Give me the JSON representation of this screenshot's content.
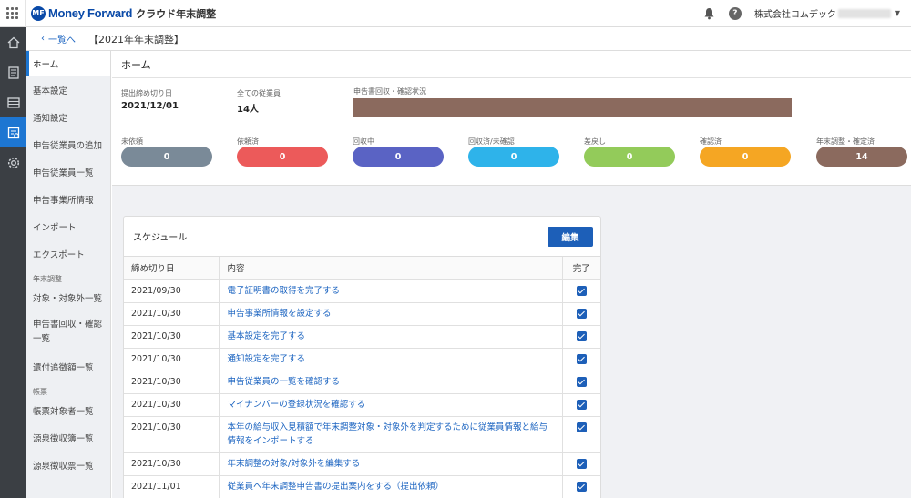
{
  "topbar": {
    "brand_mark": "MF",
    "brand_name": "Money Forward",
    "product_name": "クラウド年末調整",
    "company_name": "株式会社コムデック",
    "help_glyph": "?"
  },
  "breadcrumb": {
    "back_label": "一覧へ",
    "title": "【2021年年末調整】"
  },
  "subnav": {
    "items": [
      {
        "label": "ホーム",
        "active": true
      },
      {
        "label": "基本設定"
      },
      {
        "label": "通知設定"
      },
      {
        "label": "申告従業員の追加"
      },
      {
        "label": "申告従業員一覧"
      },
      {
        "label": "申告事業所情報"
      },
      {
        "label": "インポート"
      },
      {
        "label": "エクスポート"
      }
    ],
    "section_year_end": "年末調整",
    "year_end_items": [
      "対象・対象外一覧",
      "申告書回収・確認一覧",
      "還付追徴額一覧"
    ],
    "section_forms": "帳票",
    "form_items": [
      "帳票対象者一覧",
      "源泉徴収簿一覧",
      "源泉徴収票一覧"
    ]
  },
  "home": {
    "title": "ホーム",
    "deadline_label": "提出締め切り日",
    "deadline_value": "2021/12/01",
    "employees_label": "全ての従業員",
    "employees_value": "14人",
    "progress_label": "申告書回収・確認状況",
    "progress_fraction": 1.0,
    "progress_color": "#8b6a5e",
    "statuses": [
      {
        "label": "未依頼",
        "count": "0",
        "color": "#7a8a98"
      },
      {
        "label": "依頼済",
        "count": "0",
        "color": "#ec5a5a"
      },
      {
        "label": "回収中",
        "count": "0",
        "color": "#5a63c4"
      },
      {
        "label": "回収済/未確認",
        "count": "0",
        "color": "#2eb3ea"
      },
      {
        "label": "差戻し",
        "count": "0",
        "color": "#93cb5a"
      },
      {
        "label": "確認済",
        "count": "0",
        "color": "#f5a623"
      },
      {
        "label": "年末調整・確定済",
        "count": "14",
        "color": "#8b6a5e"
      }
    ]
  },
  "schedule": {
    "title": "スケジュール",
    "edit_label": "編集",
    "columns": [
      "締め切り日",
      "内容",
      "完了"
    ],
    "rows": [
      {
        "date": "2021/09/30",
        "task": "電子証明書の取得を完了する",
        "done": true
      },
      {
        "date": "2021/10/30",
        "task": "申告事業所情報を設定する",
        "done": true
      },
      {
        "date": "2021/10/30",
        "task": "基本設定を完了する",
        "done": true
      },
      {
        "date": "2021/10/30",
        "task": "通知設定を完了する",
        "done": true
      },
      {
        "date": "2021/10/30",
        "task": "申告従業員の一覧を確認する",
        "done": true
      },
      {
        "date": "2021/10/30",
        "task": "マイナンバーの登録状況を確認する",
        "done": true
      },
      {
        "date": "2021/10/30",
        "task": "本年の給与収入見積額で年末調整対象・対象外を判定するために従業員情報と給与情報をインポートする",
        "done": true
      },
      {
        "date": "2021/10/30",
        "task": "年末調整の対象/対象外を編集する",
        "done": true
      },
      {
        "date": "2021/11/01",
        "task": "従業員へ年末調整申告書の提出案内をする（提出依頼）",
        "done": true
      }
    ]
  }
}
